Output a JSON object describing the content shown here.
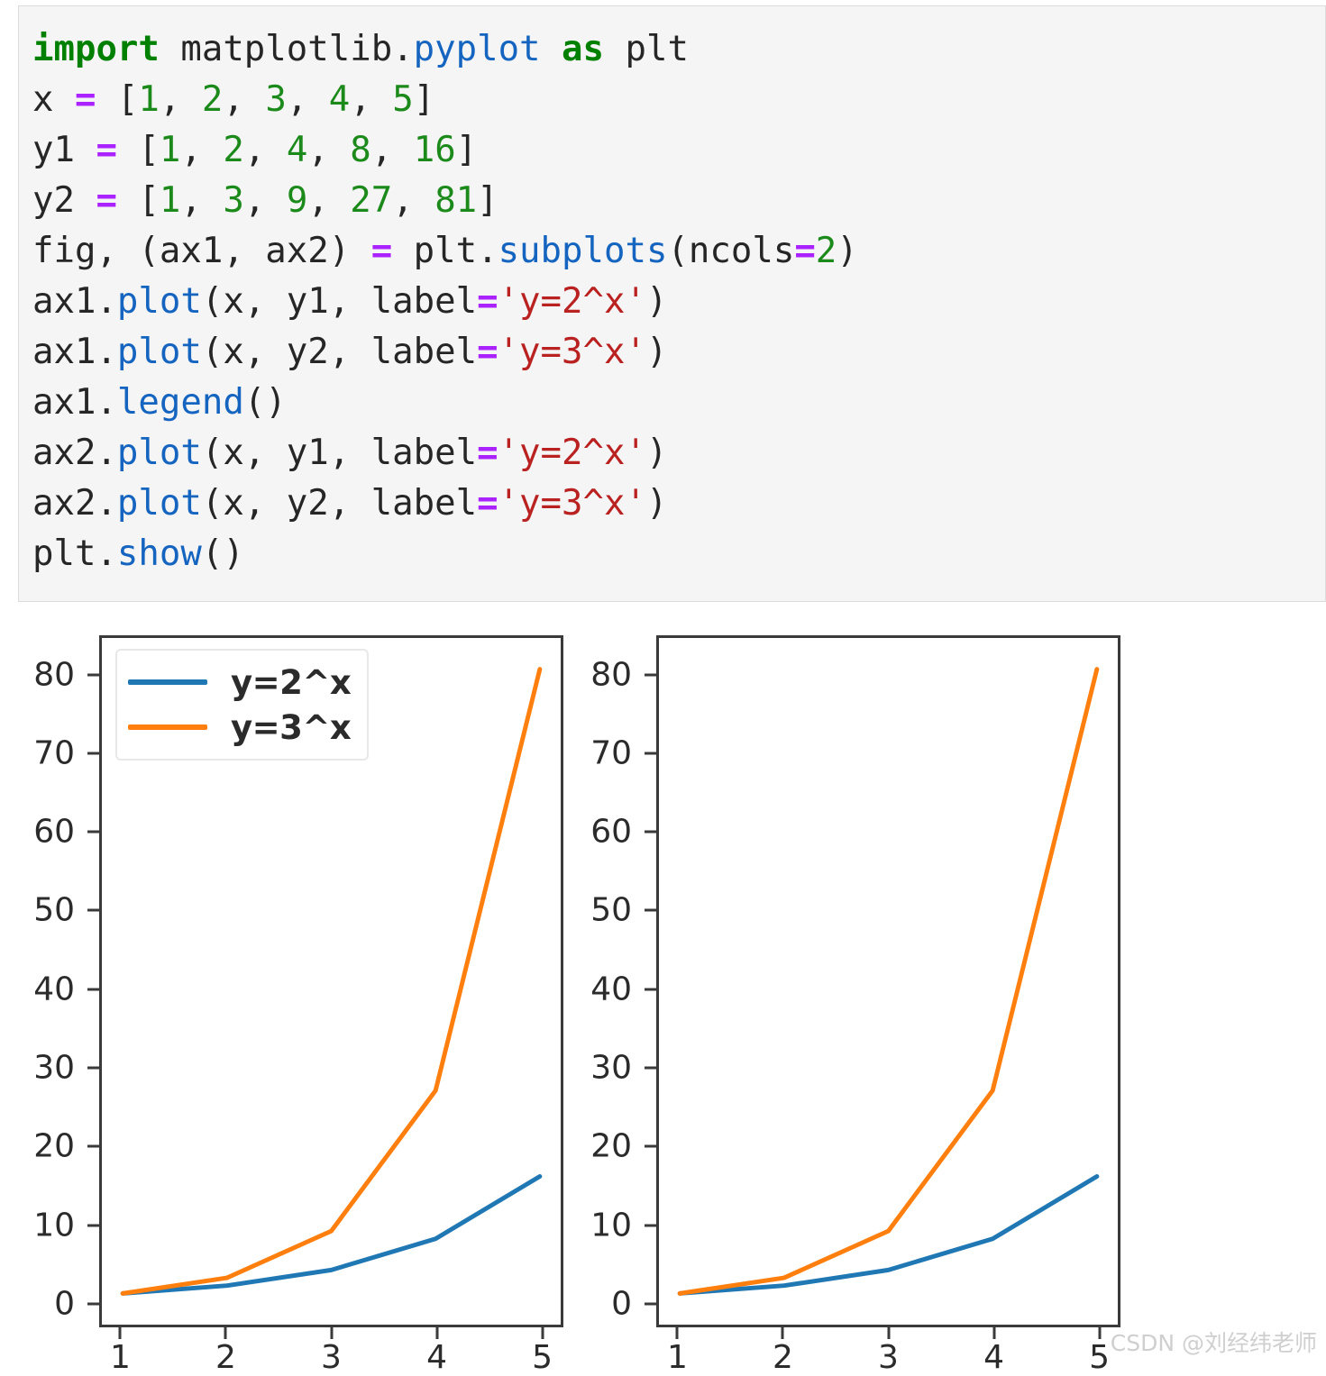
{
  "code_cell": {
    "language": "python",
    "lines": [
      [
        {
          "t": "import",
          "c": "kw"
        },
        {
          "t": " matplotlib.",
          "c": "pln"
        },
        {
          "t": "pyplot",
          "c": "mod"
        },
        {
          "t": " ",
          "c": "pln"
        },
        {
          "t": "as",
          "c": "kw"
        },
        {
          "t": " plt",
          "c": "pln"
        }
      ],
      [
        {
          "t": "x ",
          "c": "pln"
        },
        {
          "t": "=",
          "c": "op"
        },
        {
          "t": " [",
          "c": "pln"
        },
        {
          "t": "1",
          "c": "num"
        },
        {
          "t": ", ",
          "c": "pln"
        },
        {
          "t": "2",
          "c": "num"
        },
        {
          "t": ", ",
          "c": "pln"
        },
        {
          "t": "3",
          "c": "num"
        },
        {
          "t": ", ",
          "c": "pln"
        },
        {
          "t": "4",
          "c": "num"
        },
        {
          "t": ", ",
          "c": "pln"
        },
        {
          "t": "5",
          "c": "num"
        },
        {
          "t": "]",
          "c": "pln"
        }
      ],
      [
        {
          "t": "y1 ",
          "c": "pln"
        },
        {
          "t": "=",
          "c": "op"
        },
        {
          "t": " [",
          "c": "pln"
        },
        {
          "t": "1",
          "c": "num"
        },
        {
          "t": ", ",
          "c": "pln"
        },
        {
          "t": "2",
          "c": "num"
        },
        {
          "t": ", ",
          "c": "pln"
        },
        {
          "t": "4",
          "c": "num"
        },
        {
          "t": ", ",
          "c": "pln"
        },
        {
          "t": "8",
          "c": "num"
        },
        {
          "t": ", ",
          "c": "pln"
        },
        {
          "t": "16",
          "c": "num"
        },
        {
          "t": "]",
          "c": "pln"
        }
      ],
      [
        {
          "t": "y2 ",
          "c": "pln"
        },
        {
          "t": "=",
          "c": "op"
        },
        {
          "t": " [",
          "c": "pln"
        },
        {
          "t": "1",
          "c": "num"
        },
        {
          "t": ", ",
          "c": "pln"
        },
        {
          "t": "3",
          "c": "num"
        },
        {
          "t": ", ",
          "c": "pln"
        },
        {
          "t": "9",
          "c": "num"
        },
        {
          "t": ", ",
          "c": "pln"
        },
        {
          "t": "27",
          "c": "num"
        },
        {
          "t": ", ",
          "c": "pln"
        },
        {
          "t": "81",
          "c": "num"
        },
        {
          "t": "]",
          "c": "pln"
        }
      ],
      [
        {
          "t": "fig, (ax1, ax2) ",
          "c": "pln"
        },
        {
          "t": "=",
          "c": "op"
        },
        {
          "t": " plt.",
          "c": "pln"
        },
        {
          "t": "subplots",
          "c": "fn"
        },
        {
          "t": "(ncols",
          "c": "pln"
        },
        {
          "t": "=",
          "c": "op"
        },
        {
          "t": "2",
          "c": "num"
        },
        {
          "t": ")",
          "c": "pln"
        }
      ],
      [
        {
          "t": "ax1.",
          "c": "pln"
        },
        {
          "t": "plot",
          "c": "fn"
        },
        {
          "t": "(x, y1, label",
          "c": "pln"
        },
        {
          "t": "=",
          "c": "op"
        },
        {
          "t": "'y=2^x'",
          "c": "str"
        },
        {
          "t": ")",
          "c": "pln"
        }
      ],
      [
        {
          "t": "ax1.",
          "c": "pln"
        },
        {
          "t": "plot",
          "c": "fn"
        },
        {
          "t": "(x, y2, label",
          "c": "pln"
        },
        {
          "t": "=",
          "c": "op"
        },
        {
          "t": "'y=3^x'",
          "c": "str"
        },
        {
          "t": ")",
          "c": "pln"
        }
      ],
      [
        {
          "t": "ax1.",
          "c": "pln"
        },
        {
          "t": "legend",
          "c": "fn"
        },
        {
          "t": "()",
          "c": "pln"
        }
      ],
      [
        {
          "t": "ax2.",
          "c": "pln"
        },
        {
          "t": "plot",
          "c": "fn"
        },
        {
          "t": "(x, y1, label",
          "c": "pln"
        },
        {
          "t": "=",
          "c": "op"
        },
        {
          "t": "'y=2^x'",
          "c": "str"
        },
        {
          "t": ")",
          "c": "pln"
        }
      ],
      [
        {
          "t": "ax2.",
          "c": "pln"
        },
        {
          "t": "plot",
          "c": "fn"
        },
        {
          "t": "(x, y2, label",
          "c": "pln"
        },
        {
          "t": "=",
          "c": "op"
        },
        {
          "t": "'y=3^x'",
          "c": "str"
        },
        {
          "t": ")",
          "c": "pln"
        }
      ],
      [
        {
          "t": "plt.",
          "c": "pln"
        },
        {
          "t": "show",
          "c": "fn"
        },
        {
          "t": "()",
          "c": "pln"
        }
      ]
    ]
  },
  "chart_data": [
    {
      "type": "line",
      "name": "ax1",
      "title": "",
      "xlabel": "",
      "ylabel": "",
      "x": [
        1,
        2,
        3,
        4,
        5
      ],
      "series": [
        {
          "name": "y=2^x",
          "values": [
            1,
            2,
            4,
            8,
            16
          ],
          "color": "#1f77b4"
        },
        {
          "name": "y=3^x",
          "values": [
            1,
            3,
            9,
            27,
            81
          ],
          "color": "#ff7f0e"
        }
      ],
      "xticks": [
        1,
        2,
        3,
        4,
        5
      ],
      "yticks": [
        0,
        10,
        20,
        30,
        40,
        50,
        60,
        70,
        80
      ],
      "xlim": [
        0.8,
        5.2
      ],
      "ylim": [
        -3.0,
        85.0
      ],
      "grid": false,
      "legend": {
        "visible": true,
        "position": "upper left",
        "entries": [
          "y=2^x",
          "y=3^x"
        ]
      }
    },
    {
      "type": "line",
      "name": "ax2",
      "title": "",
      "xlabel": "",
      "ylabel": "",
      "x": [
        1,
        2,
        3,
        4,
        5
      ],
      "series": [
        {
          "name": "y=2^x",
          "values": [
            1,
            2,
            4,
            8,
            16
          ],
          "color": "#1f77b4"
        },
        {
          "name": "y=3^x",
          "values": [
            1,
            3,
            9,
            27,
            81
          ],
          "color": "#ff7f0e"
        }
      ],
      "xticks": [
        1,
        2,
        3,
        4,
        5
      ],
      "yticks": [
        0,
        10,
        20,
        30,
        40,
        50,
        60,
        70,
        80
      ],
      "xlim": [
        0.8,
        5.2
      ],
      "ylim": [
        -3.0,
        85.0
      ],
      "grid": false,
      "legend": {
        "visible": false,
        "position": "",
        "entries": []
      }
    }
  ],
  "watermark": {
    "text": "CSDN @刘经纬老师"
  },
  "colors": {
    "series_blue": "#1f77b4",
    "series_orange": "#ff7f0e",
    "axis": "#3a3a3a",
    "code_background": "#f5f5f5",
    "code_border": "#dcdcdc",
    "keyword": "#008000",
    "module": "#1565c0",
    "number": "#1b8a1b",
    "string": "#ba2121",
    "operator": "#aa22ff"
  }
}
